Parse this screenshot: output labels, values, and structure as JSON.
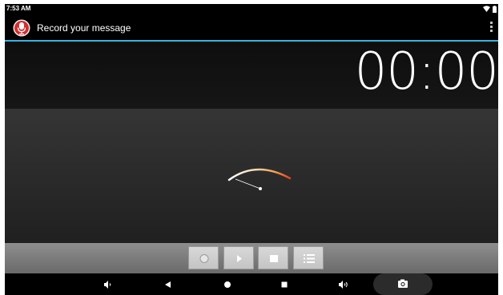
{
  "status_bar": {
    "time": "7:53 AM",
    "icons": [
      "wifi-icon",
      "battery-icon"
    ]
  },
  "action_bar": {
    "app_icon": "microphone-icon",
    "title": "Record your message",
    "menu_icon": "overflow-menu-icon"
  },
  "timer": {
    "value": "00:00"
  },
  "vu_meter": {
    "level": 0
  },
  "controls": [
    {
      "name": "record-button",
      "icon": "record-icon"
    },
    {
      "name": "play-button",
      "icon": "play-icon"
    },
    {
      "name": "stop-button",
      "icon": "stop-icon"
    },
    {
      "name": "list-button",
      "icon": "list-icon"
    }
  ],
  "navigation": [
    {
      "name": "volume-down-button",
      "icon": "volume-down-icon"
    },
    {
      "name": "back-button",
      "icon": "back-icon"
    },
    {
      "name": "home-button",
      "icon": "home-icon"
    },
    {
      "name": "recents-button",
      "icon": "recents-icon"
    },
    {
      "name": "volume-up-button",
      "icon": "volume-up-icon"
    },
    {
      "name": "screenshot-button",
      "icon": "camera-icon"
    }
  ],
  "colors": {
    "accent": "#33b5e5",
    "app_icon_red": "#d32f2f",
    "meter_warm": "#f5a050",
    "meter_hot": "#e8401a"
  }
}
